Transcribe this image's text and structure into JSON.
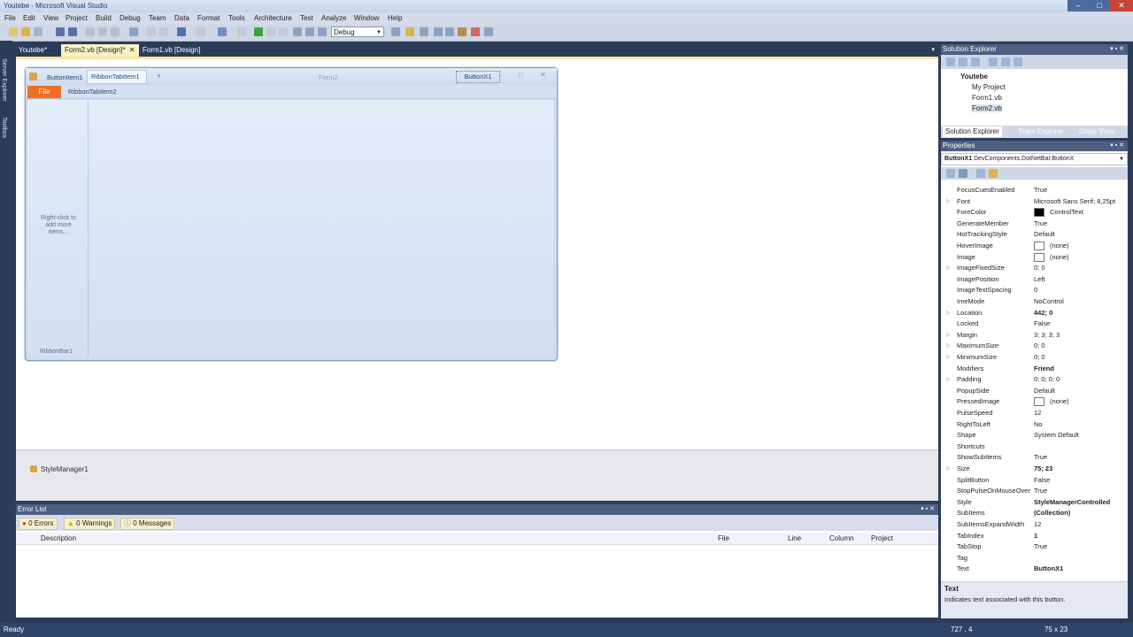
{
  "window": {
    "title": "Youtebe - Microsoft Visual Studio"
  },
  "menu": [
    "File",
    "Edit",
    "View",
    "Project",
    "Build",
    "Debug",
    "Team",
    "Data",
    "Format",
    "Tools",
    "Architecture",
    "Test",
    "Analyze",
    "Window",
    "Help"
  ],
  "toolbar": {
    "configuration": "Debug"
  },
  "left_strip": {
    "server_explorer": "Server Explorer",
    "toolbox": "Toolbox"
  },
  "doc_tabs": [
    "Youtebe*",
    "Form2.vb [Design]*",
    "Form1.vb [Design]"
  ],
  "form": {
    "title": "Form2",
    "button_item": "ButtonItem1",
    "ribbon_tab1": "RibbonTabItem1",
    "plus": "+",
    "buttonx": "ButtonX1",
    "file": "File",
    "ribbon_tab2": "RibbonTabItem2",
    "hint": "Right-click to add more items...",
    "ribbon_bar": "RibbonBar1"
  },
  "tray": {
    "style_manager": "StyleManager1"
  },
  "error_list": {
    "title": "Error List",
    "errors": "0 Errors",
    "warnings": "0 Warnings",
    "messages": "0 Messages",
    "columns": [
      "Description",
      "File",
      "Line",
      "Column",
      "Project"
    ]
  },
  "solution_explorer": {
    "title": "Solution Explorer",
    "project": "Youtebe",
    "items": [
      "My Project",
      "Form1.vb",
      "Form2.vb"
    ],
    "tabs": [
      "Solution Explorer",
      "Team Explorer",
      "Class View"
    ]
  },
  "properties": {
    "title": "Properties",
    "selected_object": "ButtonX1",
    "selected_type": "DevComponents.DotNetBar.ButtonX",
    "rows": [
      {
        "name": "FocusCuesEnabled",
        "value": "True"
      },
      {
        "name": "Font",
        "value": "Microsoft Sans Serif; 8,25pt"
      },
      {
        "name": "ForeColor",
        "value": "ControlText"
      },
      {
        "name": "GenerateMember",
        "value": "True"
      },
      {
        "name": "HotTrackingStyle",
        "value": "Default"
      },
      {
        "name": "HoverImage",
        "value": "(none)"
      },
      {
        "name": "Image",
        "value": "(none)"
      },
      {
        "name": "ImageFixedSize",
        "value": "0; 0"
      },
      {
        "name": "ImagePosition",
        "value": "Left"
      },
      {
        "name": "ImageTextSpacing",
        "value": "0"
      },
      {
        "name": "ImeMode",
        "value": "NoControl"
      },
      {
        "name": "Location",
        "value": "442; 0"
      },
      {
        "name": "Locked",
        "value": "False"
      },
      {
        "name": "Margin",
        "value": "3; 3; 3; 3"
      },
      {
        "name": "MaximumSize",
        "value": "0; 0"
      },
      {
        "name": "MinimumSize",
        "value": "0; 0"
      },
      {
        "name": "Modifiers",
        "value": "Friend"
      },
      {
        "name": "Padding",
        "value": "0; 0; 0; 0"
      },
      {
        "name": "PopupSide",
        "value": "Default"
      },
      {
        "name": "PressedImage",
        "value": "(none)"
      },
      {
        "name": "PulseSpeed",
        "value": "12"
      },
      {
        "name": "RightToLeft",
        "value": "No"
      },
      {
        "name": "Shape",
        "value": "System Default"
      },
      {
        "name": "Shortcuts",
        "value": ""
      },
      {
        "name": "ShowSubItems",
        "value": "True"
      },
      {
        "name": "Size",
        "value": "75; 23"
      },
      {
        "name": "SplitButton",
        "value": "False"
      },
      {
        "name": "StopPulseOnMouseOver",
        "value": "True"
      },
      {
        "name": "Style",
        "value": "StyleManagerControlled"
      },
      {
        "name": "SubItems",
        "value": "(Collection)"
      },
      {
        "name": "SubItemsExpandWidth",
        "value": "12"
      },
      {
        "name": "TabIndex",
        "value": "1"
      },
      {
        "name": "TabStop",
        "value": "True"
      },
      {
        "name": "Tag",
        "value": ""
      },
      {
        "name": "Text",
        "value": "ButtonX1"
      }
    ],
    "description_title": "Text",
    "description_text": "Indicates text associated with this button."
  },
  "status": {
    "text": "Ready",
    "position": "727 , 4",
    "size": "75 x 23"
  }
}
